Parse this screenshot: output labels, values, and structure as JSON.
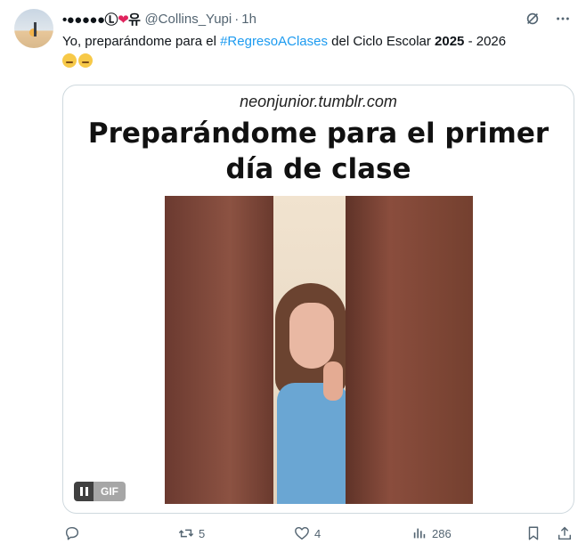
{
  "tweet": {
    "display_name_symbols": "•●●●●●Ⓛ",
    "display_name_tail": "유",
    "handle": "@Collins_Yupi",
    "separator": "·",
    "time": "1h",
    "text_before": "Yo, preparándome para el ",
    "hashtag": "#RegresoAClases",
    "text_middle": " del Ciclo Escolar ",
    "year_bold": "2025",
    "text_after": " - 2026"
  },
  "media": {
    "watermark": "neonjunior.tumblr.com",
    "caption_line1": "Preparándome para el primer",
    "caption_line2": "día de clase",
    "badge_label": "GIF"
  },
  "actions": {
    "retweets": "5",
    "likes": "4",
    "views": "286"
  },
  "icons": {
    "header": [
      "grok-icon",
      "more-icon"
    ],
    "actions": [
      "reply-icon",
      "retweet-icon",
      "like-icon",
      "views-icon",
      "bookmark-icon",
      "share-icon"
    ]
  },
  "colors": {
    "accent": "#1d9bf0",
    "text": "#0f1419",
    "muted": "#536471",
    "heart": "#e0245e"
  }
}
